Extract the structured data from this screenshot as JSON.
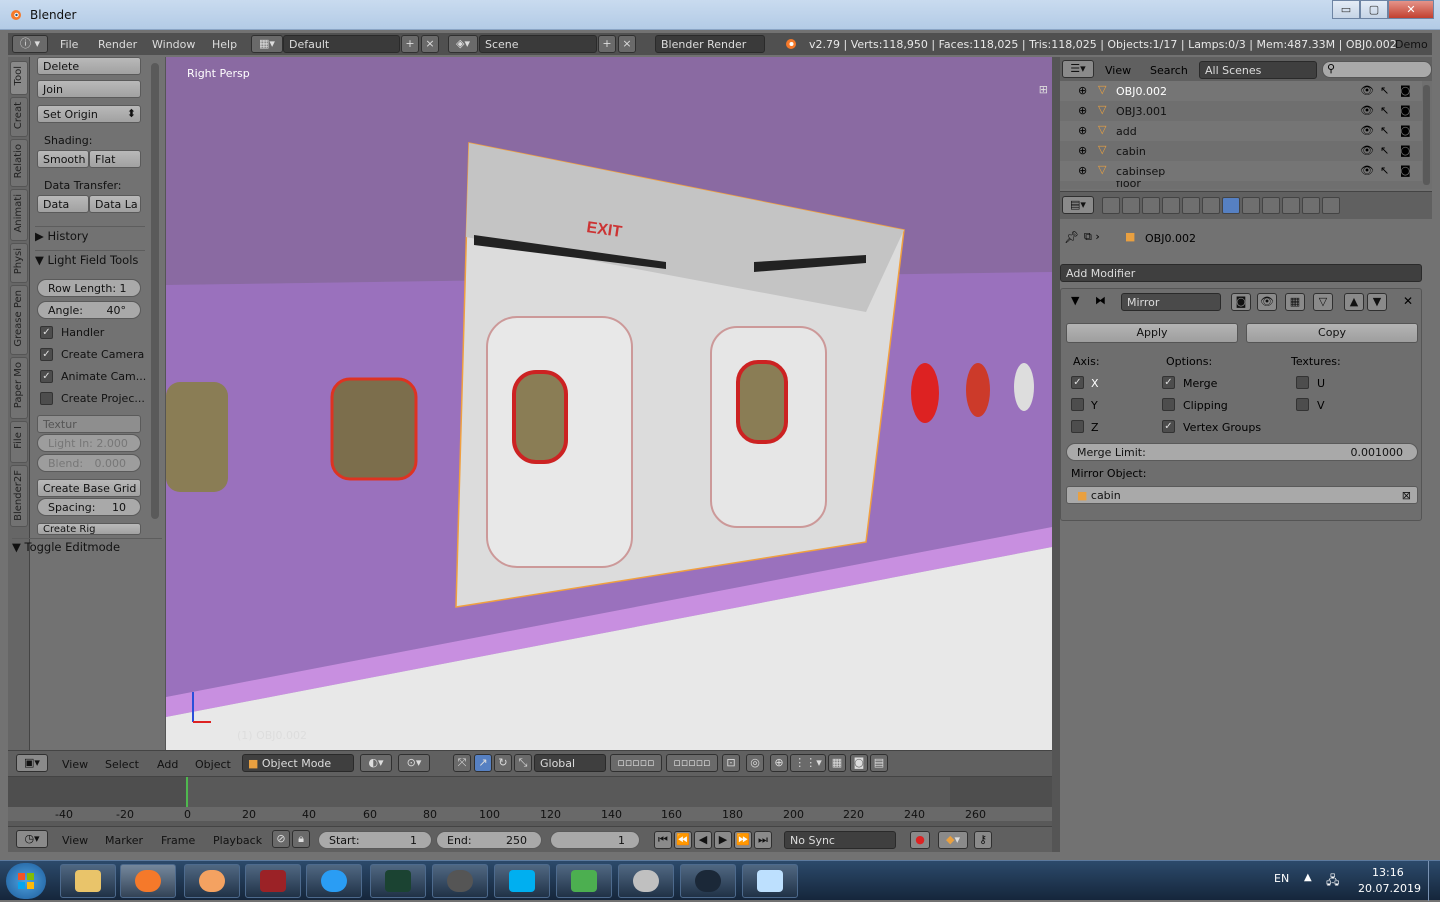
{
  "window": {
    "title": "Blender",
    "min_label": "▭",
    "max_label": "▢",
    "close_label": "✕"
  },
  "topbar": {
    "menus": [
      "File",
      "Render",
      "Window",
      "Help"
    ],
    "screen_layout": "Default",
    "scene": "Scene",
    "render_engine": "Blender Render",
    "stats": "v2.79 | Verts:118,950 | Faces:118,025 | Tris:118,025 | Objects:1/17 | Lamps:0/3 | Mem:487.33M | OBJ0.002",
    "extra": "Demo"
  },
  "left_tabs": [
    "Tool",
    "Creat",
    "Relatio",
    "Animati",
    "Physi",
    "Grease Pen",
    "Paper Mo",
    "File I",
    "Blender2F"
  ],
  "toolshelf": {
    "delete": "Delete",
    "join": "Join",
    "set_origin": "Set Origin",
    "shading_label": "Shading:",
    "smooth": "Smooth",
    "flat": "Flat",
    "data_transfer_label": "Data Transfer:",
    "data": "Data",
    "data_la": "Data La",
    "history": "History",
    "light_field_tools": "Light Field Tools",
    "row_length": "Row Length:",
    "row_length_value": "1",
    "angle": "Angle:",
    "angle_value": "40°",
    "handler": "Handler",
    "create_camera": "Create Camera",
    "animate_cam": "Animate Cam...",
    "create_projec": "Create Projec...",
    "textur": "Textur",
    "light_in": "Light In: 2.000",
    "blend": "Blend:",
    "blend_value": "0.000",
    "create_base_grid": "Create Base Grid",
    "spacing": "Spacing:",
    "spacing_value": "10",
    "create_rig": "Create Rig",
    "toggle_editmode": "Toggle Editmode"
  },
  "viewport": {
    "label": "Right Persp",
    "object_label": "(1) OBJ0.002",
    "exit_label": "EXIT"
  },
  "view_header": {
    "menus": [
      "View",
      "Select",
      "Add",
      "Object"
    ],
    "mode": "Object Mode",
    "orientation": "Global"
  },
  "timeline": {
    "ticks": [
      "-40",
      "-20",
      "0",
      "20",
      "40",
      "60",
      "80",
      "100",
      "120",
      "140",
      "160",
      "180",
      "200",
      "220",
      "240",
      "260"
    ],
    "current_frame_marker": "1"
  },
  "timeline_header": {
    "menus": [
      "View",
      "Marker",
      "Frame",
      "Playback"
    ],
    "start_label": "Start:",
    "start": "1",
    "end_label": "End:",
    "end": "250",
    "current": "1",
    "sync": "No Sync"
  },
  "outliner": {
    "view": "View",
    "search": "Search",
    "filter": "All Scenes",
    "items": [
      "OBJ0.002",
      "OBJ3.001",
      "add",
      "cabin",
      "cabinsep",
      "floor"
    ]
  },
  "properties": {
    "object_name": "OBJ0.002",
    "add_modifier": "Add Modifier",
    "modifier_name": "Mirror",
    "apply": "Apply",
    "copy": "Copy",
    "axis_label": "Axis:",
    "options_label": "Options:",
    "textures_label": "Textures:",
    "axis": [
      {
        "label": "X",
        "checked": true
      },
      {
        "label": "Y",
        "checked": false
      },
      {
        "label": "Z",
        "checked": false
      }
    ],
    "options": [
      {
        "label": "Merge",
        "checked": true
      },
      {
        "label": "Clipping",
        "checked": false
      },
      {
        "label": "Vertex Groups",
        "checked": true
      }
    ],
    "textures": [
      {
        "label": "U",
        "checked": false
      },
      {
        "label": "V",
        "checked": false
      }
    ],
    "merge_limit_label": "Merge Limit:",
    "merge_limit": "0.001000",
    "mirror_object_label": "Mirror Object:",
    "mirror_object": "cabin"
  },
  "taskbar": {
    "lang": "EN",
    "time": "13:16",
    "date": "20.07.2019"
  }
}
